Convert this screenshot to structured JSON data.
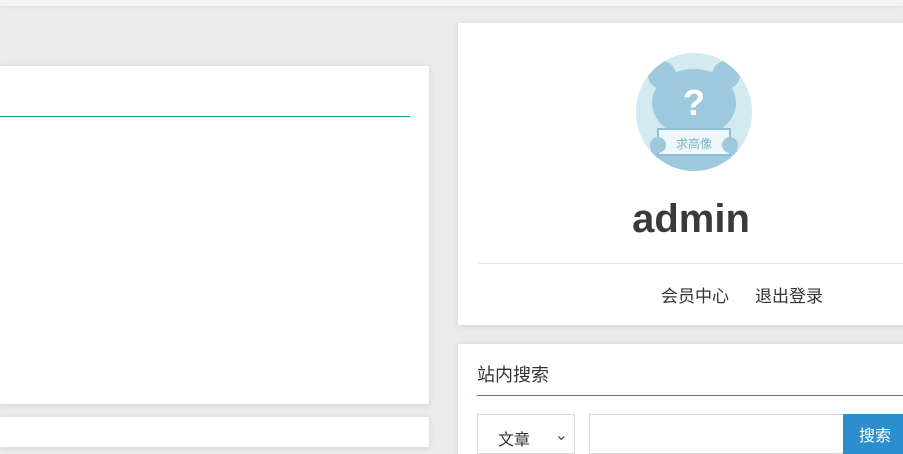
{
  "user_panel": {
    "username": "admin",
    "links": {
      "member_center": "会员中心",
      "logout": "退出登录"
    },
    "avatar_sign_text": "求高像"
  },
  "search_panel": {
    "title": "站内搜索",
    "select_value": "文章",
    "select_arrow": "⌄",
    "input_value": "",
    "button_label": "搜索"
  },
  "colors": {
    "accent_teal": "#1c9d8c",
    "search_button": "#2d8ecf",
    "page_background": "#ebebeb"
  }
}
